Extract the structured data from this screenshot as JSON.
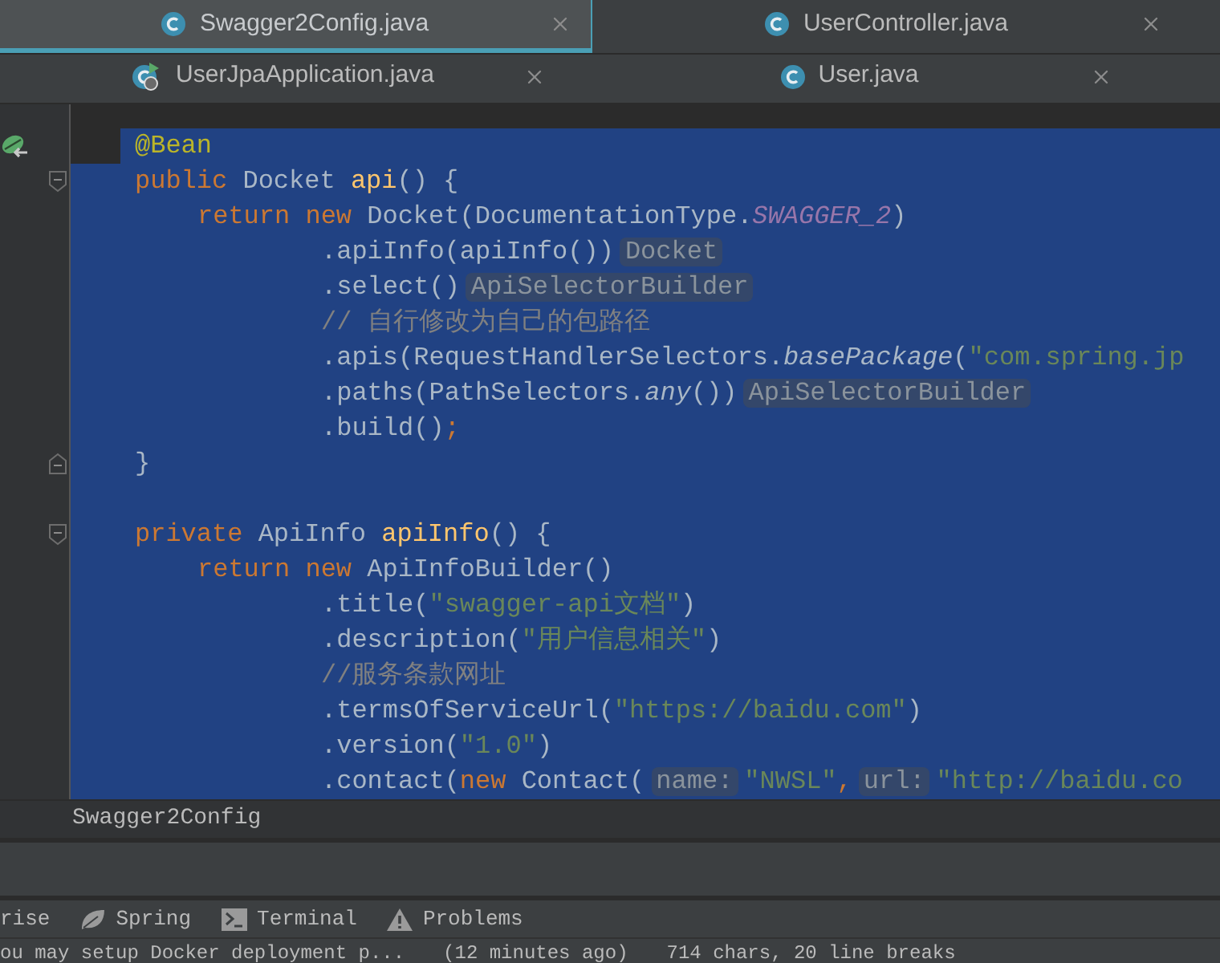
{
  "tab_rows": [
    [
      {
        "label": "Swagger2Config.java",
        "kind": "class",
        "selected": true
      },
      {
        "label": "UserController.java",
        "kind": "class",
        "selected": false
      }
    ],
    [
      {
        "label": "UserJpaApplication.java",
        "kind": "app",
        "selected": false
      },
      {
        "label": "User.java",
        "kind": "class",
        "selected": false
      }
    ]
  ],
  "editor": {
    "lines": [
      {
        "kind": "selection-start",
        "bean_marker": true,
        "tokens": [
          {
            "kind": "annotation",
            "text": "@Bean"
          }
        ]
      },
      {
        "kind": "selected",
        "fold_start": true,
        "tokens": [
          {
            "kind": "keyword",
            "text": "public "
          },
          {
            "kind": "plain",
            "text": "Docket "
          },
          {
            "kind": "method",
            "text": "api"
          },
          {
            "kind": "plain",
            "text": "() {"
          }
        ]
      },
      {
        "kind": "selected",
        "in_body": true,
        "tokens": [
          {
            "kind": "keyword",
            "text": "return new "
          },
          {
            "kind": "plain",
            "text": "Docket(DocumentationType."
          },
          {
            "kind": "constant",
            "text": "SWAGGER_2"
          },
          {
            "kind": "plain",
            "text": ")"
          }
        ]
      },
      {
        "kind": "selected",
        "chained": true,
        "tokens": [
          {
            "kind": "plain",
            "text": ".apiInfo(apiInfo())"
          },
          {
            "kind": "hint",
            "text": "Docket"
          }
        ]
      },
      {
        "kind": "selected",
        "chained": true,
        "tokens": [
          {
            "kind": "plain",
            "text": ".select()"
          },
          {
            "kind": "hint",
            "text": "ApiSelectorBuilder"
          }
        ]
      },
      {
        "kind": "selected",
        "chained": true,
        "tokens": [
          {
            "kind": "comment",
            "text": "// 自行修改为自己的包路径"
          }
        ]
      },
      {
        "kind": "selected",
        "chained": true,
        "tokens": [
          {
            "kind": "plain",
            "text": ".apis(RequestHandlerSelectors."
          },
          {
            "kind": "italic",
            "text": "basePackage"
          },
          {
            "kind": "plain",
            "text": "("
          },
          {
            "kind": "string",
            "text": "\"com.spring.jp"
          }
        ]
      },
      {
        "kind": "selected",
        "chained": true,
        "tokens": [
          {
            "kind": "plain",
            "text": ".paths(PathSelectors."
          },
          {
            "kind": "italic",
            "text": "any"
          },
          {
            "kind": "plain",
            "text": "())"
          },
          {
            "kind": "hint",
            "text": "ApiSelectorBuilder"
          }
        ]
      },
      {
        "kind": "selected",
        "chained": true,
        "tokens": [
          {
            "kind": "plain",
            "text": ".build()"
          },
          {
            "kind": "punct",
            "text": ";"
          }
        ]
      },
      {
        "kind": "selected",
        "fold_end": true,
        "tokens": [
          {
            "kind": "plain",
            "text": "}"
          }
        ]
      },
      {
        "kind": "selected"
      },
      {
        "kind": "selected",
        "fold_start": true,
        "tokens": [
          {
            "kind": "keyword",
            "text": "private "
          },
          {
            "kind": "plain",
            "text": "ApiInfo "
          },
          {
            "kind": "method",
            "text": "apiInfo"
          },
          {
            "kind": "plain",
            "text": "() {"
          }
        ]
      },
      {
        "kind": "selected",
        "in_body": true,
        "tokens": [
          {
            "kind": "keyword",
            "text": "return new "
          },
          {
            "kind": "plain",
            "text": "ApiInfoBuilder()"
          }
        ]
      },
      {
        "kind": "selected",
        "chained": true,
        "tokens": [
          {
            "kind": "plain",
            "text": ".title("
          },
          {
            "kind": "string",
            "text": "\"swagger-api文档\""
          },
          {
            "kind": "plain",
            "text": ")"
          }
        ]
      },
      {
        "kind": "selected",
        "chained": true,
        "tokens": [
          {
            "kind": "plain",
            "text": ".description("
          },
          {
            "kind": "string",
            "text": "\"用户信息相关\""
          },
          {
            "kind": "plain",
            "text": ")"
          }
        ]
      },
      {
        "kind": "selected",
        "chained": true,
        "tokens": [
          {
            "kind": "comment",
            "text": "//服务条款网址"
          }
        ]
      },
      {
        "kind": "selected",
        "chained": true,
        "tokens": [
          {
            "kind": "plain",
            "text": ".termsOfServiceUrl("
          },
          {
            "kind": "string",
            "text": "\"https://baidu.com\""
          },
          {
            "kind": "plain",
            "text": ")"
          }
        ]
      },
      {
        "kind": "selected",
        "chained": true,
        "tokens": [
          {
            "kind": "plain",
            "text": ".version("
          },
          {
            "kind": "string",
            "text": "\"1.0\""
          },
          {
            "kind": "plain",
            "text": ")"
          }
        ]
      },
      {
        "kind": "selected",
        "chained": true,
        "tokens": [
          {
            "kind": "plain",
            "text": ".contact("
          },
          {
            "kind": "keyword",
            "text": "new "
          },
          {
            "kind": "plain",
            "text": "Contact("
          },
          {
            "kind": "hint",
            "text": "name:"
          },
          {
            "kind": "string",
            "text": "\"NWSL\""
          },
          {
            "kind": "punct",
            "text": ","
          },
          {
            "kind": "hint",
            "text": "url:"
          },
          {
            "kind": "string",
            "text": "\"http://baidu.co"
          }
        ]
      }
    ]
  },
  "breadcrumb": "Swagger2Config",
  "tool_windows": [
    {
      "label": "rise",
      "kind": "none"
    },
    {
      "label": "Spring",
      "kind": "spring"
    },
    {
      "label": "Terminal",
      "kind": "terminal"
    },
    {
      "label": "Problems",
      "kind": "warning"
    }
  ],
  "status_bar": {
    "message": "ou may setup Docker deployment p...",
    "time": "(12 minutes ago)",
    "stats": "714 chars, 20 line breaks"
  }
}
